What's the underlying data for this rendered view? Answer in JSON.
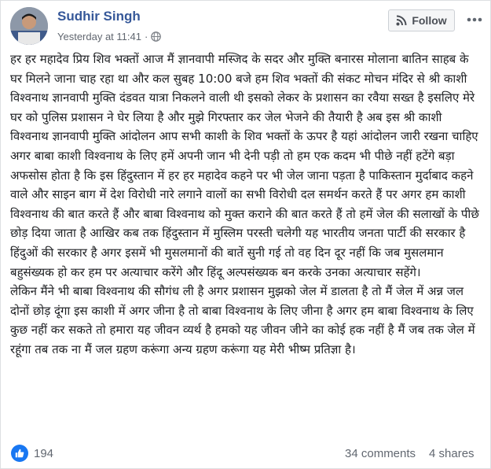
{
  "post": {
    "author": "Sudhir Singh",
    "timestamp": "Yesterday at 11:41",
    "separator": "·",
    "privacy_icon": "globe-icon",
    "follow_label": "Follow",
    "follow_icon": "rss-icon",
    "more_icon": "more-options-icon",
    "paragraphs": [
      "हर हर महादेव प्रिय शिव भक्तों आज मैं ज्ञानवापी मस्जिद के सदर और मुक्ति बनारस मोलाना बातिन साहब के घर मिलने जाना चाह रहा था और कल सुबह 10:00 बजे हम शिव भक्तों की संकट मोचन मंदिर से श्री काशी विश्वनाथ ज्ञानवापी मुक्ति दंडवत यात्रा निकलने वाली थी इसको लेकर के प्रशासन का रवैया सख्त है इसलिए मेरे घर को पुलिस प्रशासन ने घेर लिया है और मुझे गिरफ्तार कर जेल भेजने की तैयारी है अब इस श्री काशी विश्वनाथ ज्ञानवापी मुक्ति आंदोलन आप सभी काशी के शिव भक्तों के ऊपर है यहां आंदोलन जारी रखना चाहिए अगर बाबा काशी विश्वनाथ के लिए हमें अपनी जान भी देनी पड़ी तो हम एक कदम भी पीछे नहीं हटेंगे बड़ा अफसोस होता है कि इस हिंदुस्तान में हर हर महादेव कहने पर भी जेल जाना पड़ता है पाकिस्तान मुर्दाबाद कहने वाले और साइन बाग में देश विरोधी नारे लगाने वालों का सभी विरोधी दल समर्थन करते हैं पर अगर हम काशी विश्वनाथ की बात करते हैं और बाबा विश्वनाथ को मुक्त कराने की बात करते हैं तो हमें जेल की सलाखों के पीछे छोड़ दिया जाता है आखिर कब तक हिंदुस्तान में मुस्लिम परस्ती चलेगी यह भारतीय जनता पार्टी की सरकार है हिंदुओं की सरकार है अगर इसमें भी मुसलमानों की बातें सुनी गई तो वह दिन दूर नहीं कि जब मुसलमान बहुसंख्यक हो कर हम पर अत्याचार करेंगे और हिंदू अल्पसंख्यक बन करके उनका अत्याचार सहेंगे।",
      "लेकिन मैंने भी बाबा विश्वनाथ की सौगंध ली है अगर प्रशासन मुझको जेल में डालता है तो मैं जेल में अन्न जल दोनों छोड़ दूंगा इस काशी में अगर जीना है तो बाबा विश्वनाथ के लिए जीना है अगर हम बाबा विश्वनाथ के लिए कुछ नहीं कर सकते तो हमारा यह जीवन व्यर्थ है हमको यह जीवन जीने का कोई हक नहीं है मैं जब तक जेल में रहूंगा तब तक ना मैं जल ग्रहण करूंगा अन्य ग्रहण करूंगा यह मेरी भीष्म प्रतिज्ञा है।"
    ],
    "reaction_icon": "like-icon",
    "reactions": "194",
    "comments": "34 comments",
    "shares": "4 shares",
    "colors": {
      "author": "#365899",
      "meta": "#616770",
      "like_blue": "#1877f2",
      "button_bg": "#f5f6f7"
    }
  }
}
